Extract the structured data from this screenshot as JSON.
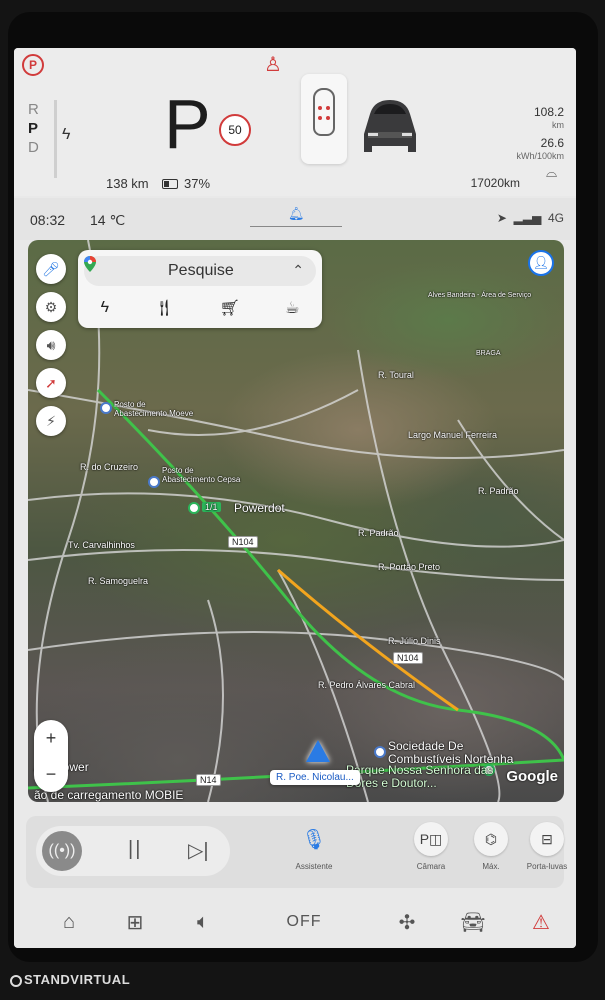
{
  "cluster": {
    "park_brake_icon": "P",
    "gears": [
      "R",
      "P",
      "D"
    ],
    "active_gear": "P",
    "gear_display": "P",
    "speed_limit": "50",
    "range": "138 km",
    "battery_pct": "37%",
    "stats": {
      "distance_value": "108.2",
      "distance_unit": "km",
      "consumption_value": "26.6",
      "consumption_unit": "kWh/100km"
    },
    "odometer": "17020km"
  },
  "status": {
    "time": "08:32",
    "temperature": "14 ℃",
    "network": "4G"
  },
  "map": {
    "search_placeholder": "Pesquise",
    "categories": [
      "charging",
      "restaurants",
      "shopping",
      "coffee"
    ],
    "labels": {
      "r_toural": "R. Toural",
      "r_padrao": "R. Padrão",
      "r_padrao2": "R. Padrão",
      "r_portao_preto": "R. Portão Preto",
      "r_samoguelra": "R. Samoguelra",
      "r_carvalhinhos": "Tv. Carvalhinhos",
      "r_cruzeiro": "R. do Cruzeiro",
      "r_pedro_alvares": "R. Pedro Álvares Cabral",
      "r_julio_dinis": "R. Júlio Dinis",
      "largo": "Largo Manuel Ferreira",
      "posto_moeve": "Posto de Abastecimento Moeve",
      "posto_cepsa": "Posto de Abastecimento Cepsa",
      "powerdot": "Powerdot",
      "charger_count": "1/1",
      "sociedade": "Sociedade De Combustíveis Nortenha",
      "parque": "Parque Nossa Senhora das Dores e Doutor...",
      "alp_power": "Alp Power",
      "mobie": "ão de carregamento MOBIE",
      "alves": "Alves Bandeira - Área de Serviço",
      "braga": "BRAGA"
    },
    "roads": {
      "n104_a": "N104",
      "n104_b": "N104",
      "n14": "N14"
    },
    "current_street": "R. Poe. Nicolau...",
    "zoom_in": "+",
    "zoom_out": "−",
    "attribution": "Google"
  },
  "media": {
    "assistant_label": "Assistente",
    "camera_label": "Câmara",
    "max_label": "Máx.",
    "trunk_label": "Porta-luvas"
  },
  "bottom_nav": {
    "climate_off": "OFF"
  },
  "watermark": "STANDVIRTUAL",
  "colors": {
    "accent": "#2a7be4",
    "warning": "#d13b3b",
    "route": "#3fc24a",
    "traffic": "#f2a51e"
  }
}
